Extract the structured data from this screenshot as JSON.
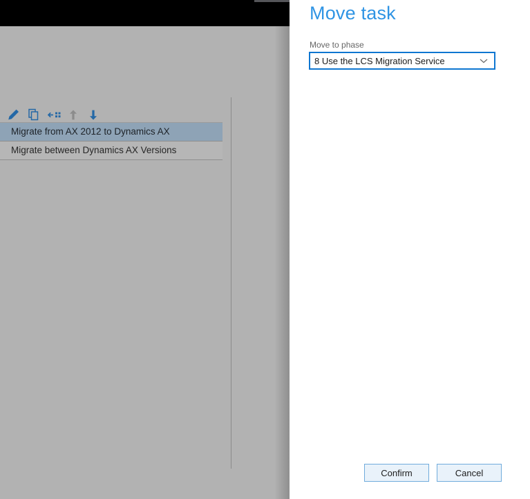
{
  "left_panel": {
    "toolbar": {
      "icons": [
        {
          "name": "edit-icon",
          "color": "#2468a6"
        },
        {
          "name": "copy-icon",
          "color": "#2468a6"
        },
        {
          "name": "move-left-icon",
          "color": "#2468a6"
        },
        {
          "name": "move-up-icon",
          "color": "#8c8c8c",
          "disabled": true
        },
        {
          "name": "move-down-icon",
          "color": "#2468a6"
        }
      ]
    },
    "tasks": [
      {
        "label": "Migrate from AX 2012 to Dynamics AX",
        "selected": true
      },
      {
        "label": "Migrate between Dynamics AX Versions",
        "selected": false
      }
    ]
  },
  "dialog": {
    "title": "Move task",
    "field": {
      "label": "Move to phase",
      "value": "8 Use the LCS Migration Service"
    },
    "buttons": {
      "confirm": "Confirm",
      "cancel": "Cancel"
    }
  },
  "colors": {
    "accent_blue": "#2f94e4",
    "dropdown_border": "#0e76d1",
    "selected_row": "#8ea3b6",
    "panel_gray": "#b2b2b2",
    "icon_blue": "#2468a6",
    "icon_disabled_gray": "#8c8c8c",
    "button_bg": "#e9f2fa",
    "button_border": "#6fabdc"
  }
}
